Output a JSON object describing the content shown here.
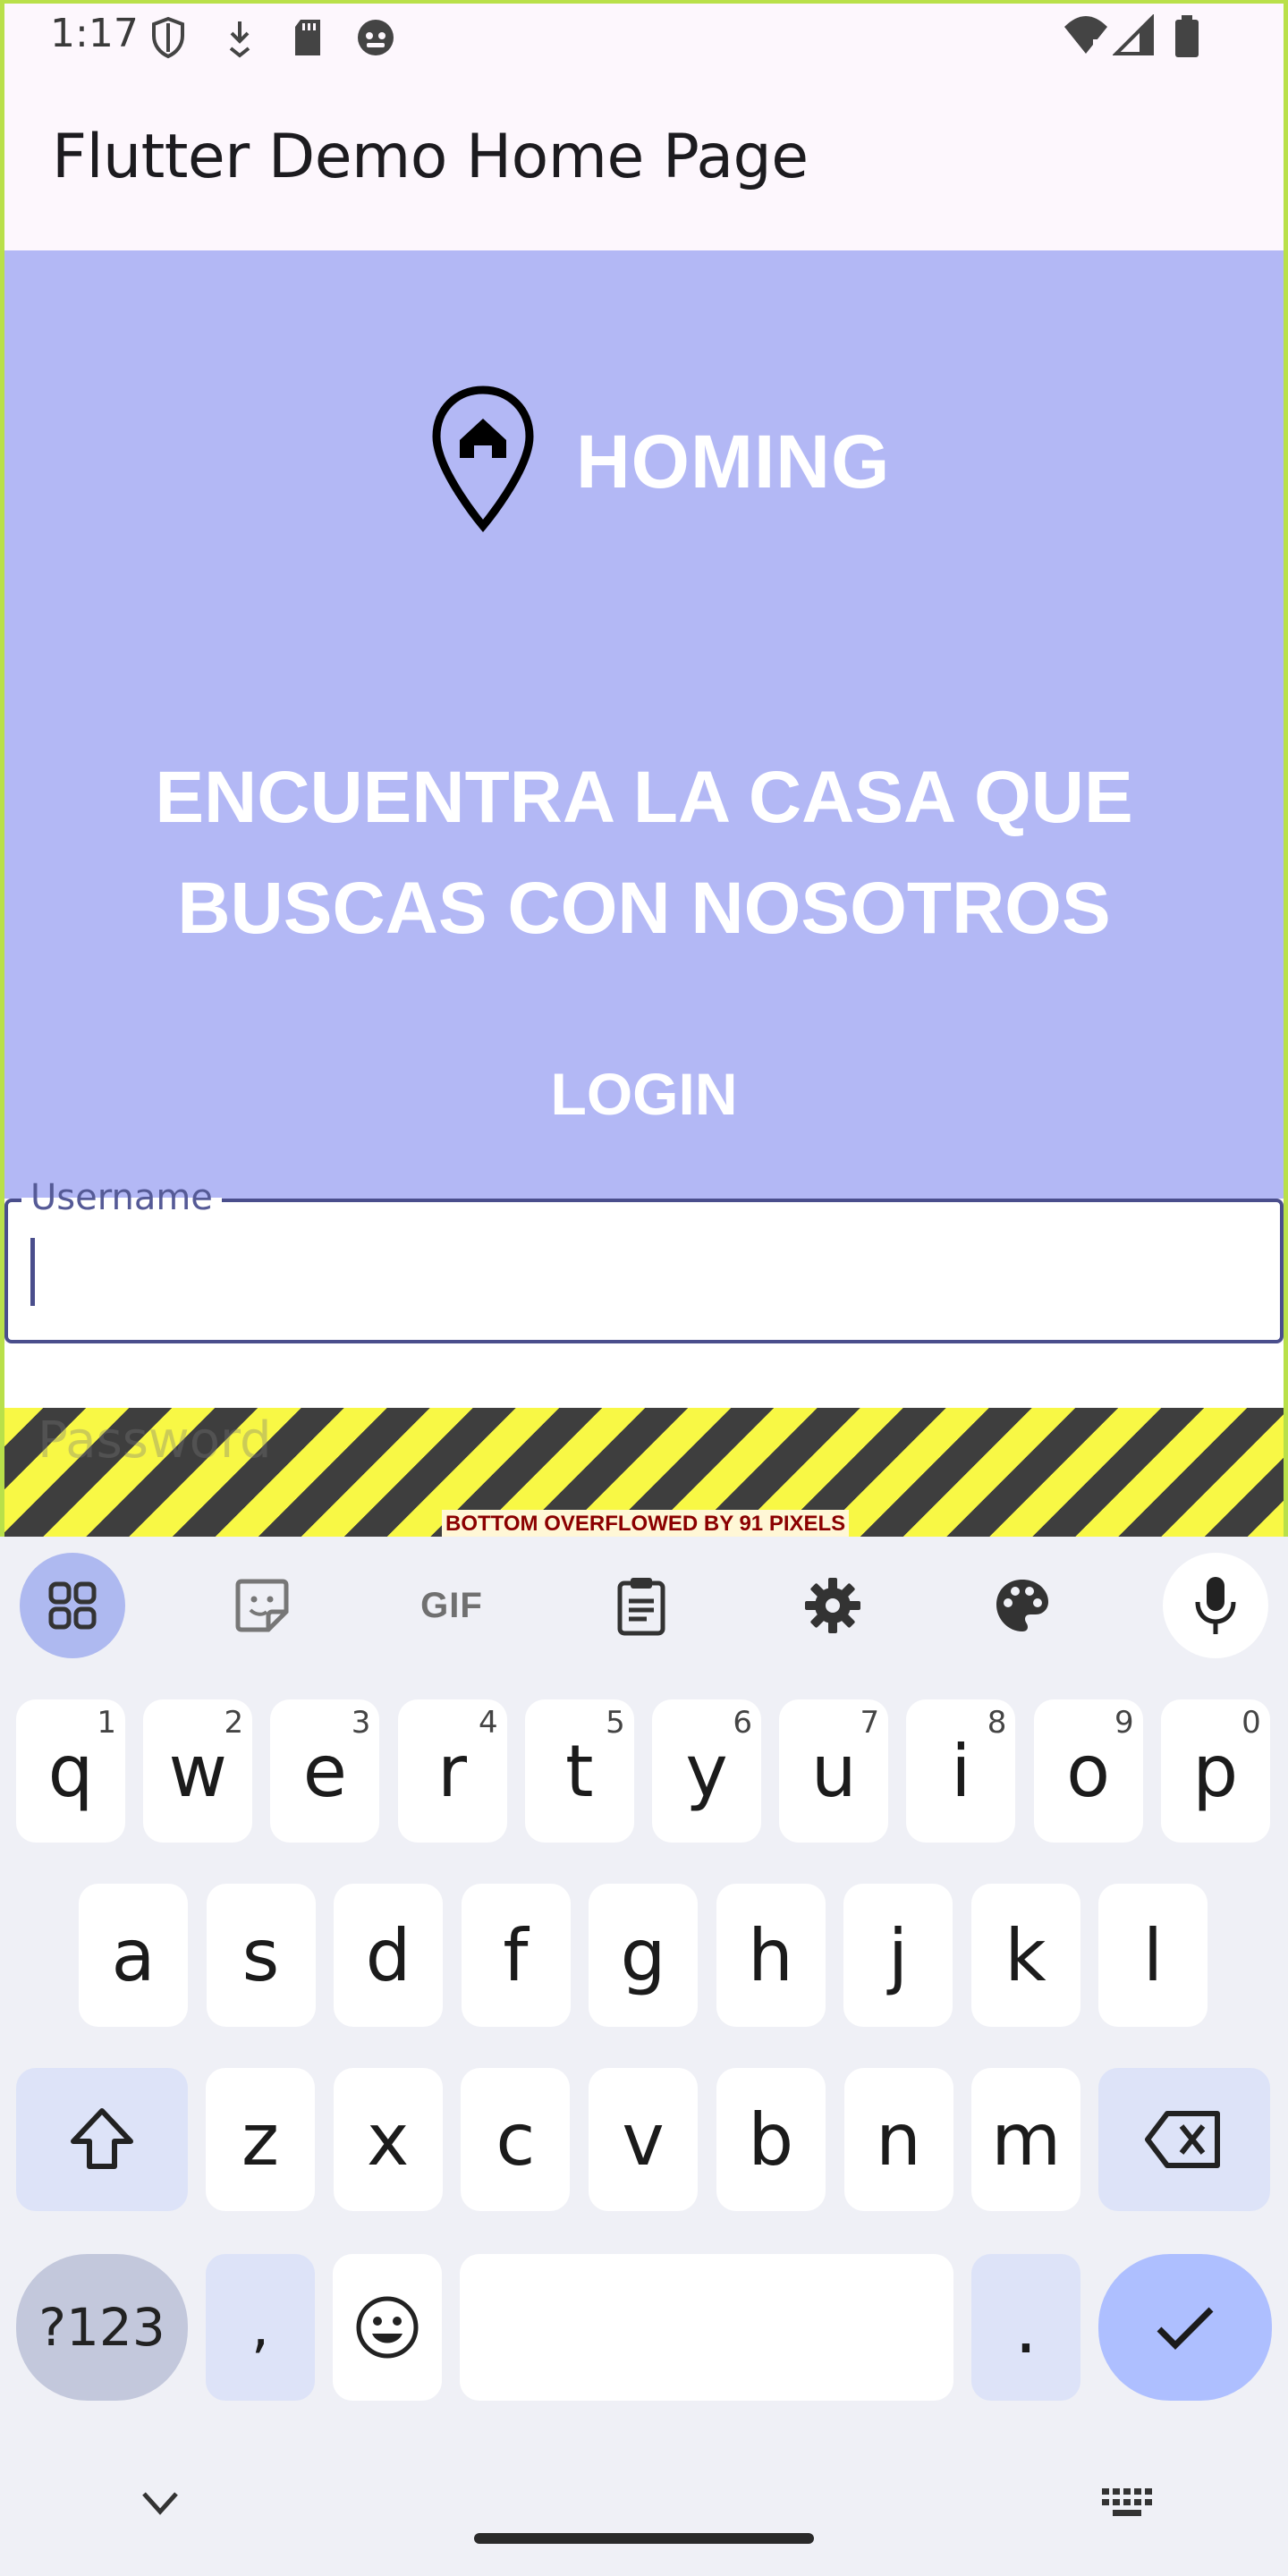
{
  "status_bar": {
    "time": "1:17"
  },
  "app_bar": {
    "title": "Flutter Demo Home Page"
  },
  "hero": {
    "brand": "HOMING",
    "tagline_line1": "ENCUENTRA LA CASA QUE",
    "tagline_line2": "BUSCAS CON NOSOTROS",
    "login_label": "LOGIN"
  },
  "form": {
    "username_label": "Username",
    "password_placeholder": "Password"
  },
  "overflow_warning": "BOTTOM OVERFLOWED BY 91 PIXELS",
  "keyboard": {
    "row1": [
      {
        "key": "q",
        "hint": "1"
      },
      {
        "key": "w",
        "hint": "2"
      },
      {
        "key": "e",
        "hint": "3"
      },
      {
        "key": "r",
        "hint": "4"
      },
      {
        "key": "t",
        "hint": "5"
      },
      {
        "key": "y",
        "hint": "6"
      },
      {
        "key": "u",
        "hint": "7"
      },
      {
        "key": "i",
        "hint": "8"
      },
      {
        "key": "o",
        "hint": "9"
      },
      {
        "key": "p",
        "hint": "0"
      }
    ],
    "row2": [
      "a",
      "s",
      "d",
      "f",
      "g",
      "h",
      "j",
      "k",
      "l"
    ],
    "row3": [
      "z",
      "x",
      "c",
      "v",
      "b",
      "n",
      "m"
    ],
    "symbols_label": "?123",
    "comma": ",",
    "period": ".",
    "toolbar_gif": "GIF",
    "colors": {
      "background": "#eff0f6",
      "special_key": "#dde3f8",
      "enter_key": "#aebfff",
      "active_tool": "#aeb9f0"
    }
  },
  "colors": {
    "hero_bg": "#b3b8f5",
    "field_border": "#4a4e8c",
    "stripe_yellow": "#f8f845",
    "stripe_dark": "#3e3e3e"
  }
}
